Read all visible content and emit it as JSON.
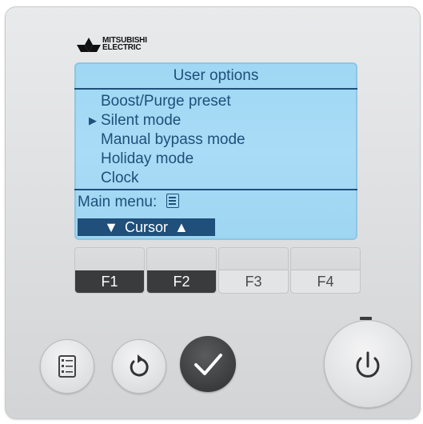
{
  "brand": {
    "line1": "MITSUBISHI",
    "line2": "ELECTRIC"
  },
  "screen": {
    "title": "User options",
    "items": [
      {
        "label": "Boost/Purge preset",
        "selected": false
      },
      {
        "label": "Silent mode",
        "selected": true
      },
      {
        "label": "Manual bypass mode",
        "selected": false
      },
      {
        "label": "Holiday mode",
        "selected": false
      },
      {
        "label": "Clock",
        "selected": false
      }
    ],
    "selector_glyph": "▶",
    "main_menu_label": "Main menu:",
    "main_menu_icon": "menu-list-icon",
    "cursor": {
      "left_glyph": "▼",
      "label": "Cursor",
      "right_glyph": "▲"
    }
  },
  "function_keys": [
    {
      "label": "F1",
      "style": "dark"
    },
    {
      "label": "F2",
      "style": "dark"
    },
    {
      "label": "F3",
      "style": "light"
    },
    {
      "label": "F4",
      "style": "light"
    }
  ],
  "buttons": {
    "menu": "menu-list-icon",
    "back": "return-arrow-icon",
    "confirm": "checkmark-icon",
    "power": "power-icon"
  },
  "colors": {
    "lcd_background": "#a6dbf5",
    "lcd_text": "#1f4f7a",
    "confirm_button": "#3b3c3e",
    "key_dark": "#3a3b3d"
  }
}
